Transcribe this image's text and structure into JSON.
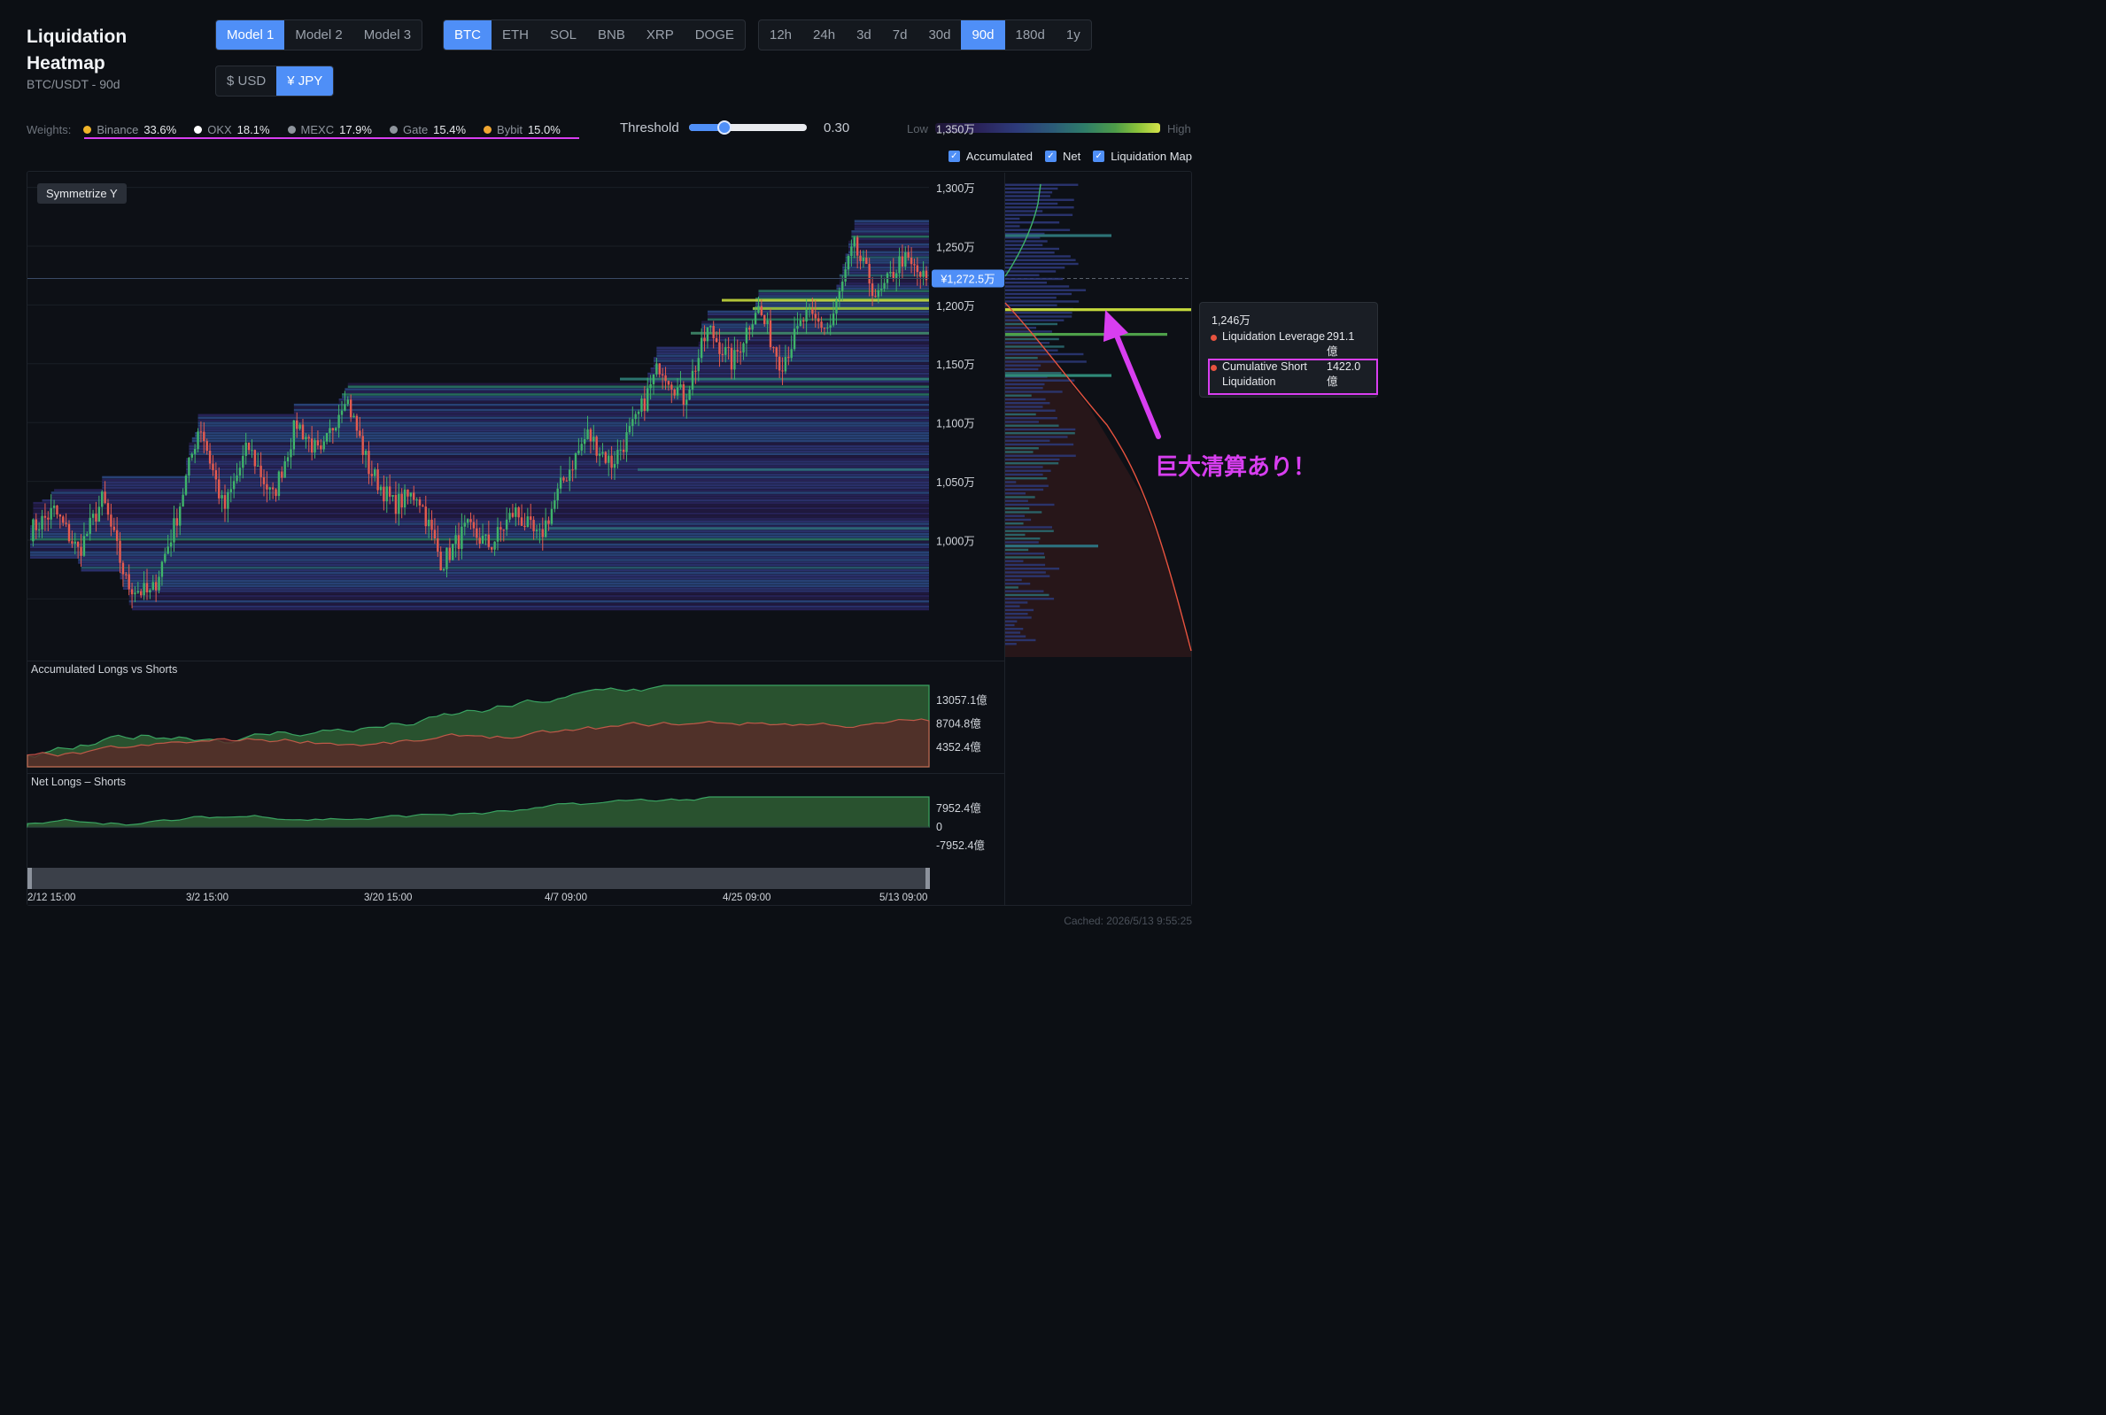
{
  "header": {
    "title": "Liquidation Heatmap",
    "subtitle": "BTC/USDT - 90d"
  },
  "models": [
    {
      "label": "Model 1",
      "active": true
    },
    {
      "label": "Model 2",
      "active": false
    },
    {
      "label": "Model 3",
      "active": false
    }
  ],
  "assets": [
    {
      "label": "BTC",
      "active": true
    },
    {
      "label": "ETH",
      "active": false
    },
    {
      "label": "SOL",
      "active": false
    },
    {
      "label": "BNB",
      "active": false
    },
    {
      "label": "XRP",
      "active": false
    },
    {
      "label": "DOGE",
      "active": false
    }
  ],
  "ranges": [
    {
      "label": "12h",
      "active": false
    },
    {
      "label": "24h",
      "active": false
    },
    {
      "label": "3d",
      "active": false
    },
    {
      "label": "7d",
      "active": false
    },
    {
      "label": "30d",
      "active": false
    },
    {
      "label": "90d",
      "active": true
    },
    {
      "label": "180d",
      "active": false
    },
    {
      "label": "1y",
      "active": false
    }
  ],
  "currencies": [
    {
      "label": "$ USD",
      "active": false
    },
    {
      "label": "¥ JPY",
      "active": true
    }
  ],
  "weights": {
    "label": "Weights:",
    "exchanges": [
      {
        "name": "Binance",
        "pct": "33.6%",
        "color": "#f0b429"
      },
      {
        "name": "OKX",
        "pct": "18.1%",
        "color": "#ffffff"
      },
      {
        "name": "MEXC",
        "pct": "17.9%",
        "color": "#8e949c"
      },
      {
        "name": "Gate",
        "pct": "15.4%",
        "color": "#8e949c"
      },
      {
        "name": "Bybit",
        "pct": "15.0%",
        "color": "#f0a631"
      }
    ]
  },
  "threshold": {
    "label": "Threshold",
    "value": "0.30",
    "level": 0.3
  },
  "legend": {
    "low": "Low",
    "high": "High"
  },
  "toggles": [
    {
      "label": "Accumulated",
      "checked": true
    },
    {
      "label": "Net",
      "checked": true
    },
    {
      "label": "Liquidation Map",
      "checked": true
    }
  ],
  "controls": {
    "symmetrize": "Symmetrize Y"
  },
  "chart_data": {
    "type": "heatmap",
    "price_axis": {
      "ticks": [
        "1,350万",
        "1,300万",
        "1,250万",
        "1,200万",
        "1,150万",
        "1,100万",
        "1,050万",
        "1,000万"
      ],
      "tick_values": [
        1350,
        1300,
        1250,
        1200,
        1150,
        1100,
        1050,
        1000
      ],
      "range": [
        958,
        1360
      ]
    },
    "current_price": {
      "label": "¥1,272.5万",
      "value": 1272.5
    },
    "time_ticks": [
      "2/12 15:00",
      "3/2 15:00",
      "3/20 15:00",
      "4/7 09:00",
      "4/25 09:00",
      "5/13 09:00"
    ],
    "price_keypoints": [
      1058,
      1075,
      1040,
      1085,
      1012,
      1003,
      1065,
      1150,
      1075,
      1130,
      1085,
      1150,
      1120,
      1175,
      1110,
      1080,
      1090,
      1030,
      1060,
      1045,
      1075,
      1050,
      1100,
      1140,
      1115,
      1150,
      1200,
      1170,
      1230,
      1200,
      1250,
      1200,
      1240,
      1230,
      1300,
      1255,
      1290,
      1270
    ],
    "accumulated": {
      "title": "Accumulated Longs vs Shorts",
      "ticks": [
        "13057.1億",
        "8704.8億",
        "4352.4億"
      ]
    },
    "net": {
      "title": "Net Longs – Shorts",
      "ticks": [
        "7952.4億",
        "0",
        "-7952.4億"
      ]
    }
  },
  "tooltip": {
    "title": "1,246万",
    "rows": [
      {
        "name": "Liquidation Leverage",
        "value": "291.1 億"
      },
      {
        "name": "Cumulative Short Liquidation",
        "value": "1422.0 億"
      }
    ]
  },
  "annotation": {
    "text": "巨大清算あり！"
  },
  "footer": {
    "cached": "Cached: 2026/5/13 9:55:25"
  }
}
